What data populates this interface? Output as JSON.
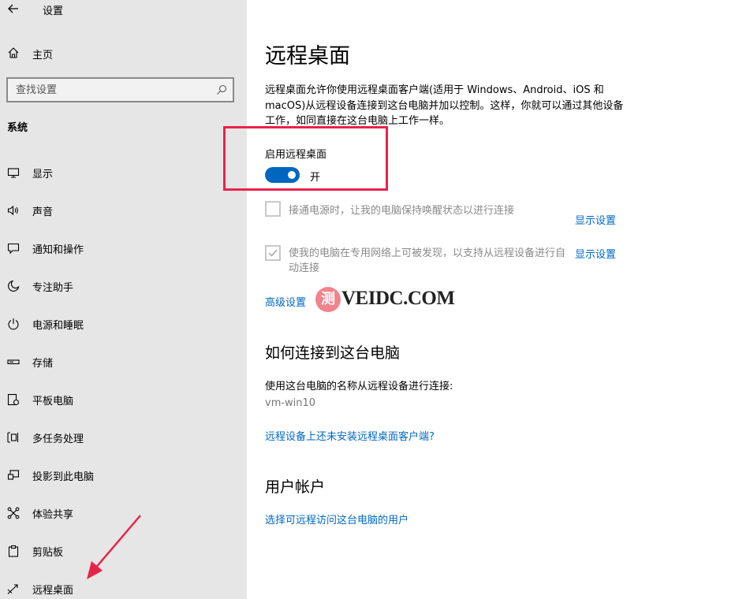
{
  "window": {
    "title": "设置"
  },
  "sidebar": {
    "home_label": "主页",
    "search_placeholder": "查找设置",
    "section_label": "系统",
    "items": [
      {
        "label": "显示",
        "icon": "monitor-icon"
      },
      {
        "label": "声音",
        "icon": "speaker-icon"
      },
      {
        "label": "通知和操作",
        "icon": "notification-icon"
      },
      {
        "label": "专注助手",
        "icon": "moon-icon"
      },
      {
        "label": "电源和睡眠",
        "icon": "power-icon"
      },
      {
        "label": "存储",
        "icon": "storage-icon"
      },
      {
        "label": "平板电脑",
        "icon": "tablet-icon"
      },
      {
        "label": "多任务处理",
        "icon": "multitask-icon"
      },
      {
        "label": "投影到此电脑",
        "icon": "project-icon"
      },
      {
        "label": "体验共享",
        "icon": "share-icon"
      },
      {
        "label": "剪贴板",
        "icon": "clipboard-icon"
      },
      {
        "label": "远程桌面",
        "icon": "remote-desktop-icon"
      }
    ]
  },
  "main": {
    "title": "远程桌面",
    "description": "远程桌面允许你使用远程桌面客户端(适用于 Windows、Android、iOS 和 macOS)从远程设备连接到这台电脑并加以控制。这样，你就可以通过其他设备工作，如同直接在这台电脑上工作一样。",
    "toggle_label": "启用远程桌面",
    "toggle_state": "开",
    "toggle_on": true,
    "option1_label": "接通电源时，让我的电脑保持唤醒状态以进行连接",
    "option1_checked": false,
    "option2_label": "使我的电脑在专用网络上可被发现，以支持从远程设备进行自动连接",
    "option2_checked": true,
    "show_settings": "显示设置",
    "advanced_settings": "高级设置",
    "watermark_glyph": "测",
    "watermark_text": "VEIDC.COM",
    "how_to_connect_heading": "如何连接到这台电脑",
    "connect_description": "使用这台电脑的名称从远程设备进行连接:",
    "pc_name": "vm-win10",
    "no_client_link": "远程设备上还未安装远程桌面客户端?",
    "user_accounts_heading": "用户帐户",
    "select_users_link": "选择可远程访问这台电脑的用户"
  },
  "colors": {
    "accent": "#0067c0",
    "highlight": "#e8234a",
    "sidebar_bg": "#e6e6e6"
  }
}
